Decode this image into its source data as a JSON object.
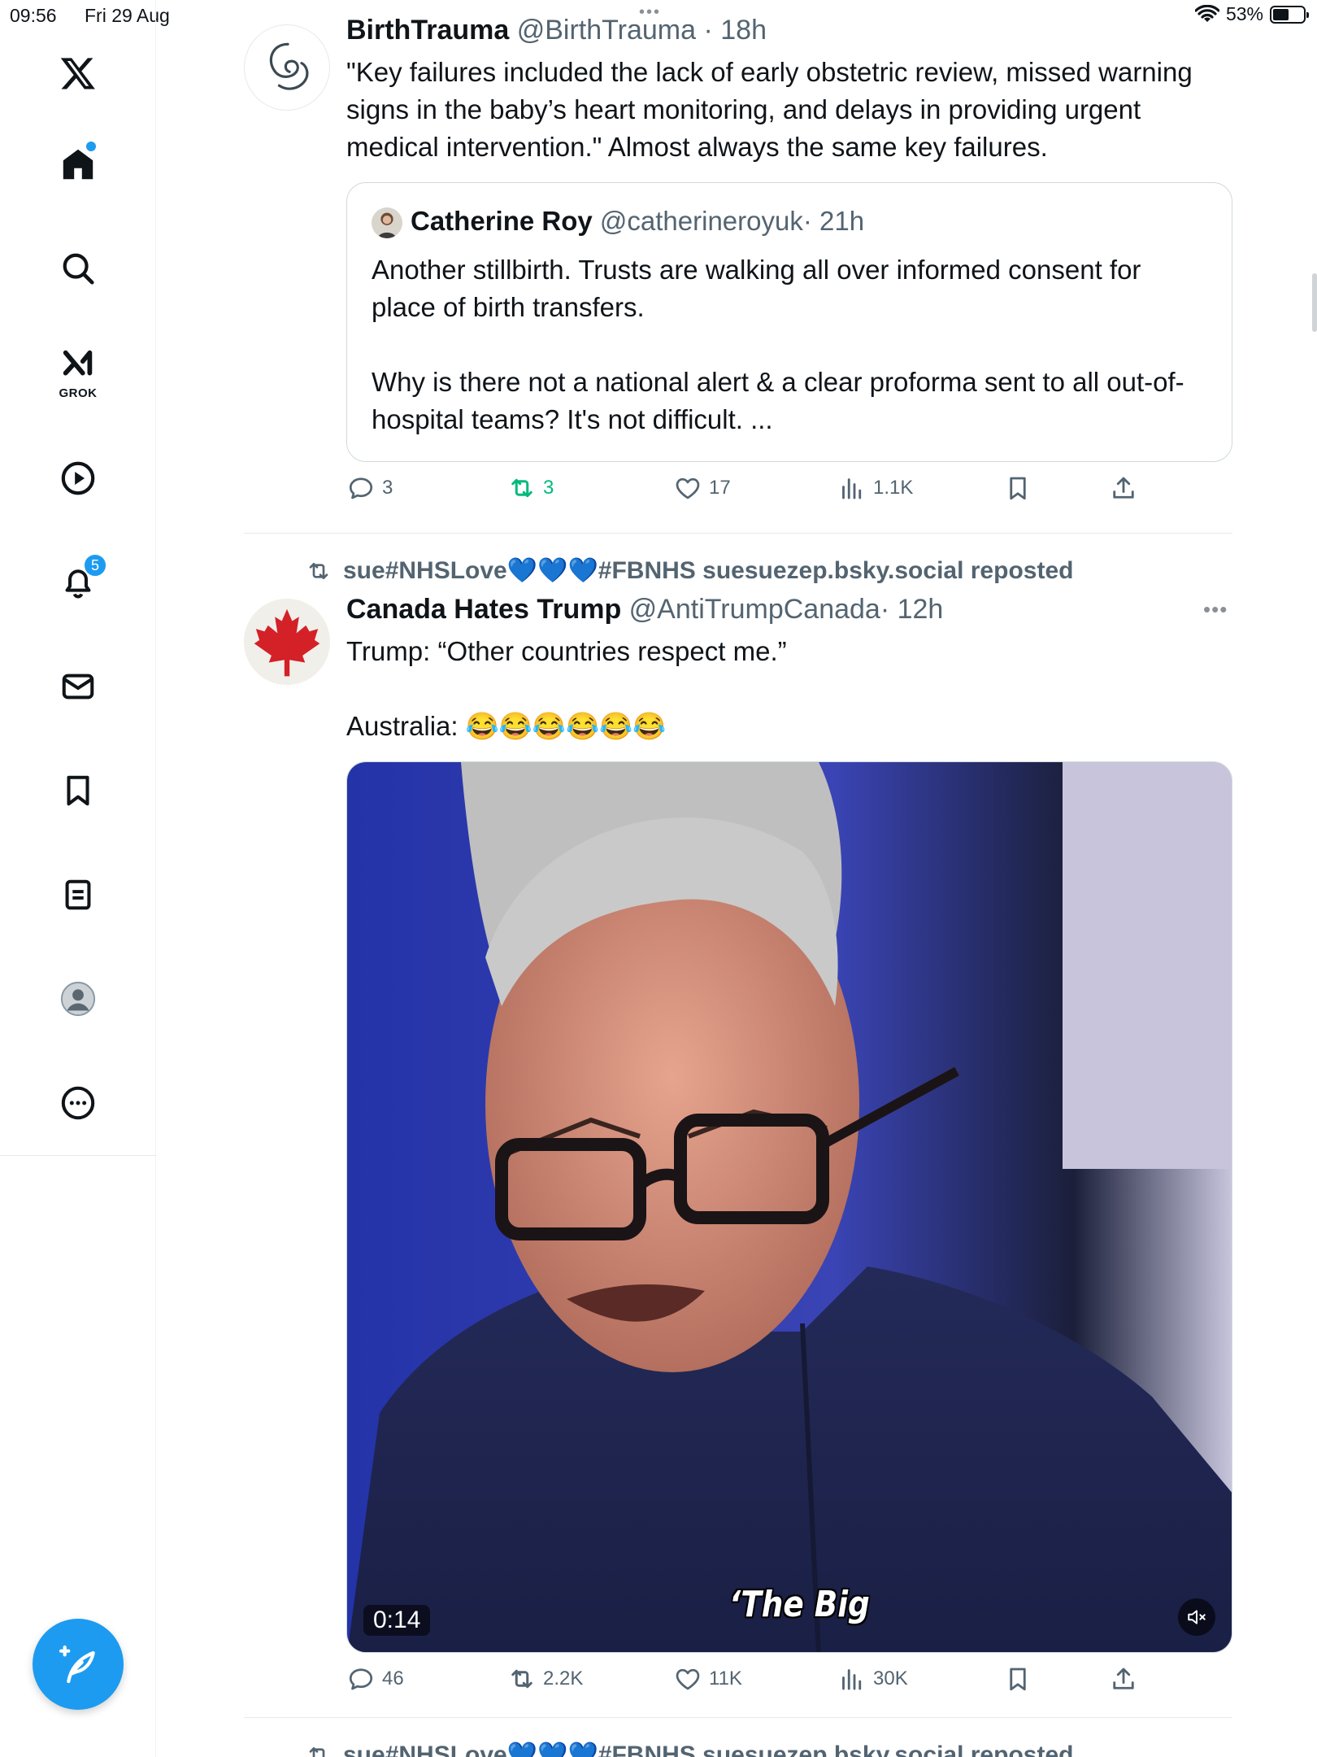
{
  "status_bar": {
    "time": "09:56",
    "date": "Fri 29 Aug",
    "battery": "53%",
    "battery_level": 0.53
  },
  "sidebar": {
    "grok_label": "GROK",
    "notifications_count": "5",
    "items": [
      "x-logo-icon",
      "home-icon",
      "search-icon",
      "grok-icon",
      "video-icon",
      "notifications-icon",
      "messages-icon",
      "bookmarks-icon",
      "lists-icon",
      "profile-icon",
      "more-icon"
    ]
  },
  "tweet1": {
    "name": "BirthTrauma",
    "handle": "@BirthTrauma",
    "time": "· 18h",
    "text": "\"Key failures included the lack of early obstetric review, missed warning signs in the baby’s heart monitoring, and delays in providing urgent medical intervention.\" Almost always the same key failures.",
    "quote": {
      "name": "Catherine Roy",
      "handle": "@catherineroyuk",
      "time": "· 21h",
      "text": "Another stillbirth. Trusts are walking all over informed consent for place of birth transfers.\n\nWhy is there not a national alert & a clear proforma sent to all out-of-hospital teams? It's not difficult. ..."
    },
    "replies": "3",
    "reposts": "3",
    "likes": "17",
    "views": "1.1K"
  },
  "tweet2": {
    "repost_by": "sue#NHSLove💙💙💙#FBNHS suesuezep.bsky.social reposted",
    "name": "Canada Hates Trump",
    "handle": "@AntiTrumpCanada",
    "time": "· 12h",
    "text": "Trump: “Other countries respect me.”\n\nAustralia: 😂😂😂😂😂😂",
    "video_time": "0:14",
    "video_caption": "‘The Big",
    "replies": "46",
    "reposts": "2.2K",
    "likes": "11K",
    "views": "30K"
  },
  "tweet3": {
    "repost_by": "sue#NHSLove💙💙💙#FBNHS suesuezep.bsky.social reposted"
  },
  "colors": {
    "accent": "#1d9bf0",
    "repost_green": "#00ba7c",
    "muted": "#536471"
  }
}
